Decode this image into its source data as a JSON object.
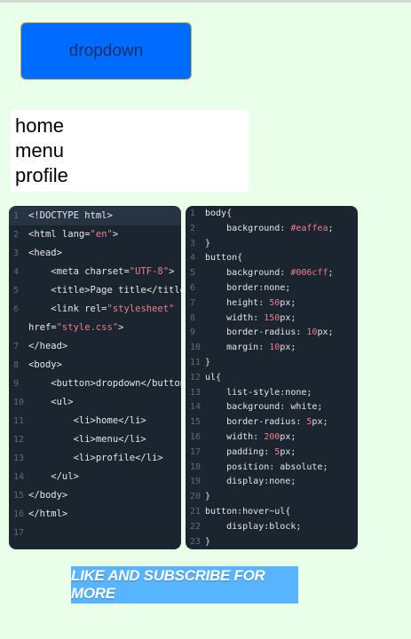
{
  "button": {
    "label": "dropdown"
  },
  "menu": {
    "items": [
      "home",
      "menu",
      "profile"
    ]
  },
  "html_code": {
    "lines": [
      {
        "n": "1",
        "t": "<!DOCTYPE html>"
      },
      {
        "n": "2",
        "t": "<html lang=\"en\">"
      },
      {
        "n": "3",
        "t": "<head>"
      },
      {
        "n": "4",
        "t": "    <meta charset=\"UTF-8\">"
      },
      {
        "n": "5",
        "t": "    <title>Page title</title>"
      },
      {
        "n": "6",
        "t": "    <link rel=\"stylesheet\""
      },
      {
        "n": "",
        "t": "href=\"style.css\">"
      },
      {
        "n": "7",
        "t": "</head>"
      },
      {
        "n": "8",
        "t": "<body>"
      },
      {
        "n": "9",
        "t": "    <button>dropdown</button>"
      },
      {
        "n": "10",
        "t": "    <ul>"
      },
      {
        "n": "11",
        "t": "        <li>home</li>"
      },
      {
        "n": "12",
        "t": "        <li>menu</li>"
      },
      {
        "n": "13",
        "t": "        <li>profile</li>"
      },
      {
        "n": "14",
        "t": "    </ul>"
      },
      {
        "n": "15",
        "t": "</body>"
      },
      {
        "n": "16",
        "t": "</html>"
      },
      {
        "n": "17",
        "t": ""
      }
    ]
  },
  "css_code": {
    "lines": [
      {
        "n": "1",
        "t": "body{"
      },
      {
        "n": "2",
        "t": "    background: #eaffea;"
      },
      {
        "n": "3",
        "t": "}"
      },
      {
        "n": "4",
        "t": "button{"
      },
      {
        "n": "5",
        "t": "    background: #006cff;"
      },
      {
        "n": "6",
        "t": "    border:none;"
      },
      {
        "n": "7",
        "t": "    height: 50px;"
      },
      {
        "n": "8",
        "t": "    width: 150px;"
      },
      {
        "n": "9",
        "t": "    border-radius: 10px;"
      },
      {
        "n": "10",
        "t": "    margin: 10px;"
      },
      {
        "n": "11",
        "t": "}"
      },
      {
        "n": "12",
        "t": "ul{"
      },
      {
        "n": "13",
        "t": "    list-style:none;"
      },
      {
        "n": "14",
        "t": "    background: white;"
      },
      {
        "n": "15",
        "t": "    border-radius: 5px;"
      },
      {
        "n": "16",
        "t": "    width: 200px;"
      },
      {
        "n": "17",
        "t": "    padding: 5px;"
      },
      {
        "n": "18",
        "t": "    position: absolute;"
      },
      {
        "n": "19",
        "t": "    display:none;"
      },
      {
        "n": "20",
        "t": "}"
      },
      {
        "n": "21",
        "t": "button:hover~ul{"
      },
      {
        "n": "22",
        "t": "    display:block;"
      },
      {
        "n": "23",
        "t": "}"
      }
    ]
  },
  "banner": {
    "text": "LIKE AND SUBSCRIBE FOR MORE"
  },
  "colors": {
    "page_bg": "#eaffea",
    "button_bg": "#006cff",
    "editor_bg": "#1b2530",
    "string_color": "#f07c8a",
    "banner_bg": "#58b4ff"
  }
}
